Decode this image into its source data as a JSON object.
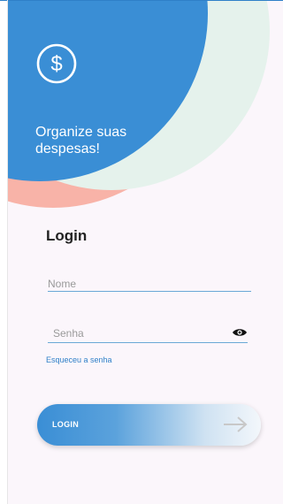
{
  "header": {
    "tagline": "Organize suas despesas!",
    "icon": "dollar-icon"
  },
  "login": {
    "title": "Login",
    "name_placeholder": "Nome",
    "password_placeholder": "Senha",
    "forgot_label": "Esqueceu a senha",
    "button_label": "LOGIN"
  },
  "colors": {
    "primary": "#3a8ed5",
    "accent_pink": "#f8b3a8",
    "accent_mint": "#e5f2ec",
    "background": "#fbf6fb"
  }
}
